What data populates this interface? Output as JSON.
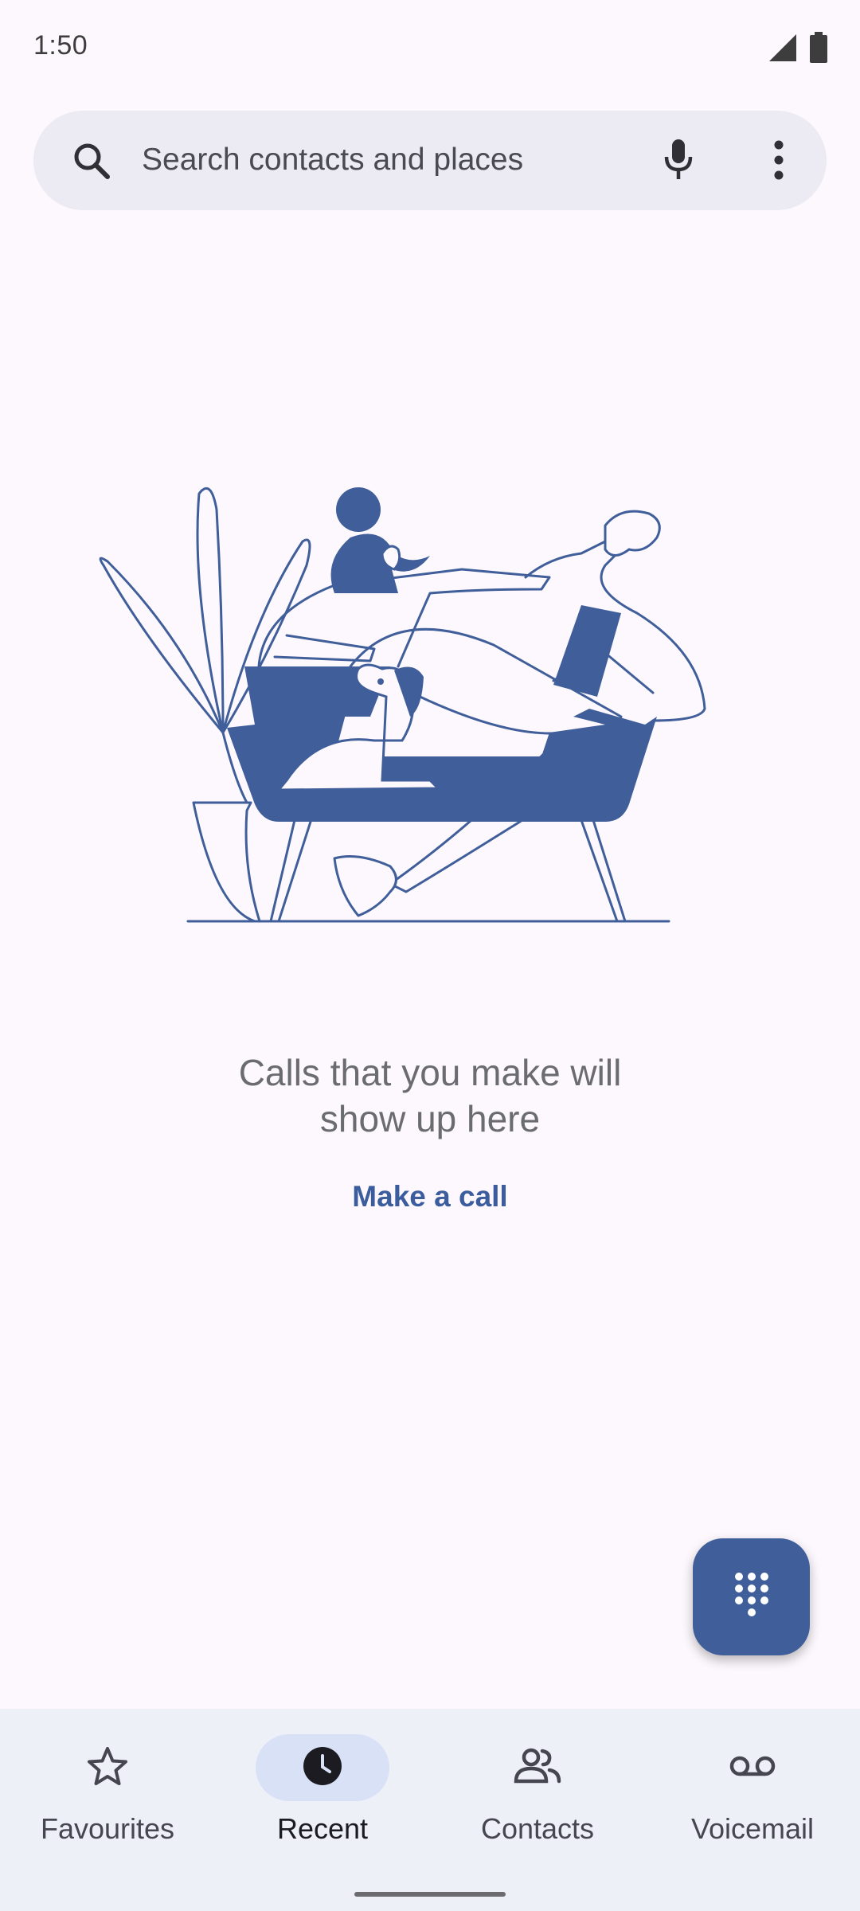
{
  "status_bar": {
    "time": "1:50",
    "signal_icon": "cell-signal-icon",
    "battery_icon": "battery-icon"
  },
  "search": {
    "placeholder": "Search contacts and places",
    "search_icon": "search-icon",
    "mic_icon": "mic-icon",
    "more_icon": "more-vert-icon"
  },
  "empty_state": {
    "illustration": "person-and-dog-on-sofa-illustration",
    "message_line1": "Calls that you make will",
    "message_line2": "show up here",
    "action_label": "Make a call"
  },
  "fab": {
    "icon": "dialpad-icon"
  },
  "bottom_nav": {
    "items": [
      {
        "label": "Favourites",
        "icon": "star-icon",
        "active": false
      },
      {
        "label": "Recent",
        "icon": "clock-icon",
        "active": true
      },
      {
        "label": "Contacts",
        "icon": "people-icon",
        "active": false
      },
      {
        "label": "Voicemail",
        "icon": "voicemail-icon",
        "active": false
      }
    ]
  },
  "colors": {
    "background": "#fdf8fd",
    "accent": "#3f5e9a",
    "search_bar": "#eceaf2",
    "nav_bar": "#eef0f8",
    "nav_active_pill": "#d9e1f6"
  }
}
